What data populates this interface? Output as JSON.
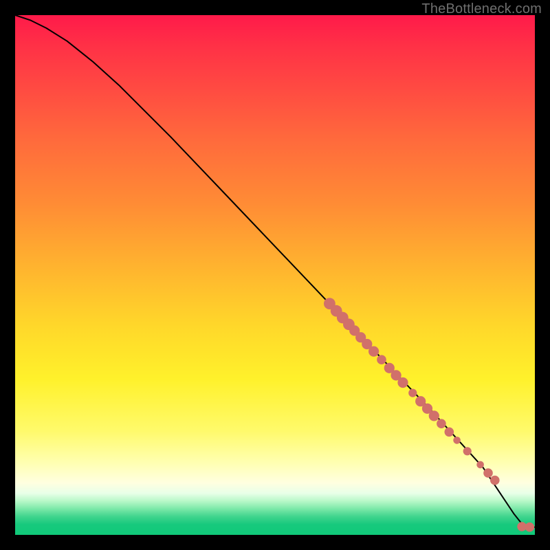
{
  "watermark": "TheBottleneck.com",
  "background_gradient": {
    "stops": [
      {
        "pos": 0.0,
        "color": "#ff1a4a"
      },
      {
        "pos": 0.5,
        "color": "#ffd82a"
      },
      {
        "pos": 0.9,
        "color": "#ffffe0"
      },
      {
        "pos": 1.0,
        "color": "#10c979"
      }
    ]
  },
  "chart_data": {
    "type": "line",
    "title": "",
    "xlabel": "",
    "ylabel": "",
    "xlim": [
      0,
      100
    ],
    "ylim": [
      0,
      100
    ],
    "series": [
      {
        "name": "bottleneck-curve",
        "x": [
          0,
          3,
          6,
          10,
          15,
          20,
          30,
          40,
          50,
          60,
          70,
          80,
          90,
          94,
          96,
          98,
          100
        ],
        "y": [
          100,
          99,
          97.5,
          95,
          91,
          86.5,
          76.5,
          66,
          55.5,
          45,
          34.5,
          24,
          13,
          7,
          4,
          1.5,
          1.5
        ]
      }
    ],
    "markers": [
      {
        "x": 60.5,
        "y": 44.5,
        "r": 1.1
      },
      {
        "x": 61.8,
        "y": 43.1,
        "r": 1.1
      },
      {
        "x": 63.0,
        "y": 41.8,
        "r": 1.1
      },
      {
        "x": 64.2,
        "y": 40.5,
        "r": 1.1
      },
      {
        "x": 65.3,
        "y": 39.3,
        "r": 1.0
      },
      {
        "x": 66.5,
        "y": 38.0,
        "r": 1.0
      },
      {
        "x": 67.7,
        "y": 36.7,
        "r": 1.0
      },
      {
        "x": 69.0,
        "y": 35.3,
        "r": 1.0
      },
      {
        "x": 70.5,
        "y": 33.7,
        "r": 0.9
      },
      {
        "x": 72.0,
        "y": 32.1,
        "r": 1.0
      },
      {
        "x": 73.3,
        "y": 30.7,
        "r": 1.0
      },
      {
        "x": 74.6,
        "y": 29.3,
        "r": 1.0
      },
      {
        "x": 76.5,
        "y": 27.3,
        "r": 0.8
      },
      {
        "x": 78.0,
        "y": 25.7,
        "r": 1.0
      },
      {
        "x": 79.3,
        "y": 24.3,
        "r": 1.0
      },
      {
        "x": 80.6,
        "y": 22.9,
        "r": 1.0
      },
      {
        "x": 82.0,
        "y": 21.4,
        "r": 0.9
      },
      {
        "x": 83.5,
        "y": 19.8,
        "r": 0.9
      },
      {
        "x": 85.0,
        "y": 18.2,
        "r": 0.7
      },
      {
        "x": 87.0,
        "y": 16.1,
        "r": 0.8
      },
      {
        "x": 89.5,
        "y": 13.5,
        "r": 0.7
      },
      {
        "x": 91.0,
        "y": 11.9,
        "r": 0.9
      },
      {
        "x": 92.3,
        "y": 10.5,
        "r": 0.9
      },
      {
        "x": 97.5,
        "y": 1.6,
        "r": 0.9
      },
      {
        "x": 99.0,
        "y": 1.5,
        "r": 0.9
      }
    ],
    "marker_color": "#d1706a",
    "line_color": "#000000"
  }
}
